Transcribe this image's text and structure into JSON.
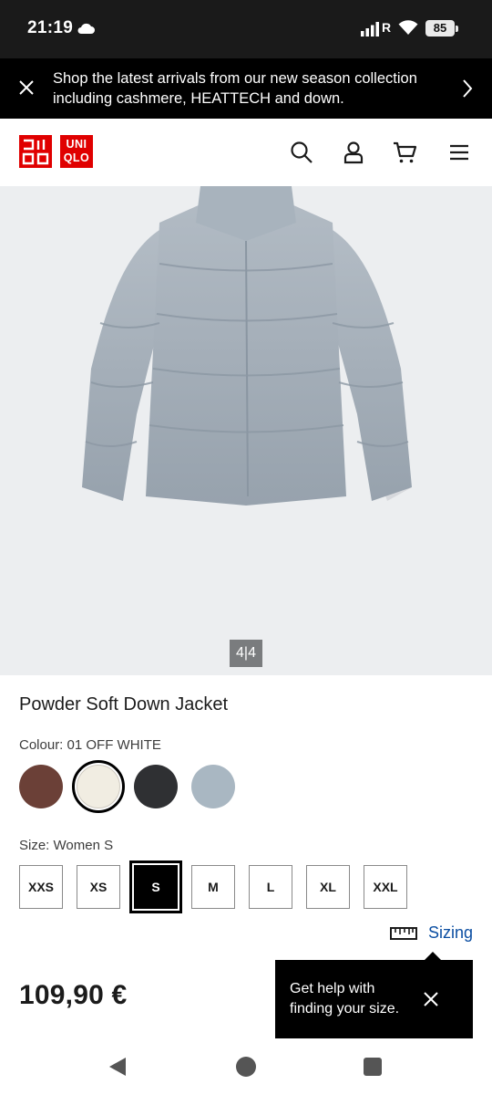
{
  "status_bar": {
    "time": "21:19",
    "signal_suffix": "R",
    "battery": "85",
    "icons": [
      "cloud-icon",
      "signal-icon",
      "wifi-icon",
      "battery-icon"
    ]
  },
  "promo": {
    "text": "Shop the latest arrivals from our new season collection including cashmere, HEATTECH and down.",
    "icons": [
      "close-icon",
      "chevron-right-icon"
    ]
  },
  "header": {
    "logo_line1": "UNI",
    "logo_line2": "QLO",
    "icons": [
      "search-icon",
      "account-icon",
      "cart-icon",
      "menu-icon"
    ]
  },
  "gallery": {
    "counter": "4|4"
  },
  "product": {
    "title": "Powder Soft Down Jacket",
    "colour_label": "Colour: 01 OFF WHITE",
    "colours": [
      {
        "name": "brown",
        "hex": "#6b4037"
      },
      {
        "name": "off-white",
        "hex": "#f1ede2",
        "selected": true
      },
      {
        "name": "dark-grey",
        "hex": "#2f3033"
      },
      {
        "name": "blue-grey",
        "hex": "#a9b7c2"
      }
    ],
    "size_label": "Size: Women S",
    "sizes": [
      "XXS",
      "XS",
      "S",
      "M",
      "L",
      "XL",
      "XXL"
    ],
    "selected_size": "S",
    "sizing_label": "Sizing",
    "price": "109,90 €"
  },
  "tooltip": {
    "text": "Get help with finding your size."
  },
  "colors": {
    "brand_red": "#e00000",
    "link_blue": "#0b4ea2",
    "black": "#000000"
  }
}
